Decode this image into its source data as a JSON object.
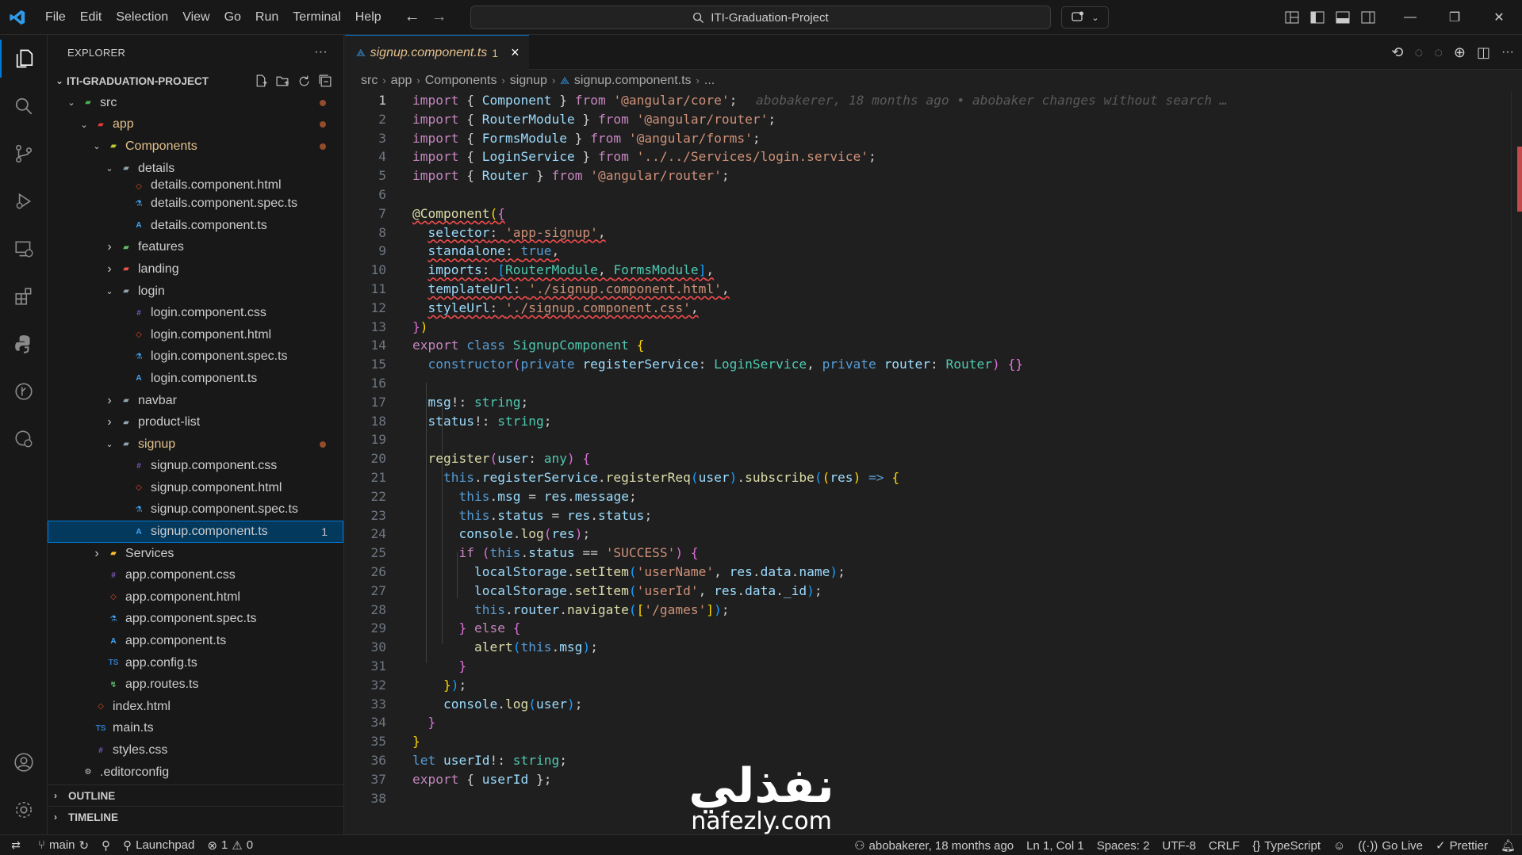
{
  "menu": [
    "File",
    "Edit",
    "Selection",
    "View",
    "Go",
    "Run",
    "Terminal",
    "Help"
  ],
  "search": {
    "label": "ITI-Graduation-Project"
  },
  "sidebar": {
    "title": "EXPLORER",
    "project": "ITI-GRADUATION-PROJECT",
    "tree": [
      {
        "label": "src",
        "depth": 1,
        "type": "folder-open",
        "icon": "src-folder-icon",
        "modified": true
      },
      {
        "label": "app",
        "depth": 2,
        "type": "folder-open",
        "icon": "app-folder-icon",
        "modified": true
      },
      {
        "label": "Components",
        "depth": 3,
        "type": "folder-open",
        "icon": "components-folder-icon",
        "modified": true
      },
      {
        "label": "details",
        "depth": 4,
        "type": "folder-open",
        "icon": "folder-icon"
      },
      {
        "label": "details.component.html",
        "depth": 5,
        "type": "file",
        "icon": "html-file-icon"
      },
      {
        "label": "details.component.spec.ts",
        "depth": 5,
        "type": "file",
        "icon": "spec-file-icon"
      },
      {
        "label": "details.component.ts",
        "depth": 5,
        "type": "file",
        "icon": "angular-file-icon"
      },
      {
        "label": "features",
        "depth": 4,
        "type": "folder",
        "icon": "features-folder-icon"
      },
      {
        "label": "landing",
        "depth": 4,
        "type": "folder",
        "icon": "landing-folder-icon"
      },
      {
        "label": "login",
        "depth": 4,
        "type": "folder-open",
        "icon": "folder-icon"
      },
      {
        "label": "login.component.css",
        "depth": 5,
        "type": "file",
        "icon": "css-file-icon"
      },
      {
        "label": "login.component.html",
        "depth": 5,
        "type": "file",
        "icon": "html-file-icon"
      },
      {
        "label": "login.component.spec.ts",
        "depth": 5,
        "type": "file",
        "icon": "spec-file-icon"
      },
      {
        "label": "login.component.ts",
        "depth": 5,
        "type": "file",
        "icon": "angular-file-icon"
      },
      {
        "label": "navbar",
        "depth": 4,
        "type": "folder",
        "icon": "folder-icon"
      },
      {
        "label": "product-list",
        "depth": 4,
        "type": "folder",
        "icon": "folder-icon"
      },
      {
        "label": "signup",
        "depth": 4,
        "type": "folder-open",
        "icon": "folder-icon",
        "modified": true
      },
      {
        "label": "signup.component.css",
        "depth": 5,
        "type": "file",
        "icon": "css-file-icon"
      },
      {
        "label": "signup.component.html",
        "depth": 5,
        "type": "file",
        "icon": "html-file-icon"
      },
      {
        "label": "signup.component.spec.ts",
        "depth": 5,
        "type": "file",
        "icon": "spec-file-icon"
      },
      {
        "label": "signup.component.ts",
        "depth": 5,
        "type": "file",
        "icon": "angular-file-icon",
        "selected": true,
        "count": "1"
      },
      {
        "label": "Services",
        "depth": 3,
        "type": "folder",
        "icon": "services-folder-icon"
      },
      {
        "label": "app.component.css",
        "depth": 3,
        "type": "file",
        "icon": "css-file-icon"
      },
      {
        "label": "app.component.html",
        "depth": 3,
        "type": "file",
        "icon": "html-file-icon"
      },
      {
        "label": "app.component.spec.ts",
        "depth": 3,
        "type": "file",
        "icon": "spec-file-icon"
      },
      {
        "label": "app.component.ts",
        "depth": 3,
        "type": "file",
        "icon": "angular-file-icon"
      },
      {
        "label": "app.config.ts",
        "depth": 3,
        "type": "file",
        "icon": "ts-file-icon"
      },
      {
        "label": "app.routes.ts",
        "depth": 3,
        "type": "file",
        "icon": "routes-file-icon"
      },
      {
        "label": "index.html",
        "depth": 2,
        "type": "file",
        "icon": "html-file-icon"
      },
      {
        "label": "main.ts",
        "depth": 2,
        "type": "file",
        "icon": "ts-file-icon"
      },
      {
        "label": "styles.css",
        "depth": 2,
        "type": "file",
        "icon": "css-file-icon"
      },
      {
        "label": ".editorconfig",
        "depth": 1,
        "type": "file",
        "icon": "editorconfig-file-icon"
      }
    ],
    "outline": "OUTLINE",
    "timeline": "TIMELINE"
  },
  "tab": {
    "name": "signup.component.ts",
    "problems": "1",
    "close": "×"
  },
  "breadcrumbs": [
    "src",
    "app",
    "Components",
    "signup",
    "signup.component.ts",
    "..."
  ],
  "blame": "abobakerer, 18 months ago • abobaker changes without search …",
  "code": [
    [
      [
        "kw2",
        "import"
      ],
      [
        "pl",
        " { "
      ],
      [
        "va",
        "Component"
      ],
      [
        "pl",
        " } "
      ],
      [
        "kw2",
        "from"
      ],
      [
        "pl",
        " "
      ],
      [
        "str",
        "'@angular/core'"
      ],
      [
        "pl",
        ";"
      ]
    ],
    [
      [
        "kw2",
        "import"
      ],
      [
        "pl",
        " { "
      ],
      [
        "va",
        "RouterModule"
      ],
      [
        "pl",
        " } "
      ],
      [
        "kw2",
        "from"
      ],
      [
        "pl",
        " "
      ],
      [
        "str",
        "'@angular/router'"
      ],
      [
        "pl",
        ";"
      ]
    ],
    [
      [
        "kw2",
        "import"
      ],
      [
        "pl",
        " { "
      ],
      [
        "va",
        "FormsModule"
      ],
      [
        "pl",
        " } "
      ],
      [
        "kw2",
        "from"
      ],
      [
        "pl",
        " "
      ],
      [
        "str",
        "'@angular/forms'"
      ],
      [
        "pl",
        ";"
      ]
    ],
    [
      [
        "kw2",
        "import"
      ],
      [
        "pl",
        " { "
      ],
      [
        "va",
        "LoginService"
      ],
      [
        "pl",
        " } "
      ],
      [
        "kw2",
        "from"
      ],
      [
        "pl",
        " "
      ],
      [
        "str",
        "'../../Services/login.service'"
      ],
      [
        "pl",
        ";"
      ]
    ],
    [
      [
        "kw2",
        "import"
      ],
      [
        "pl",
        " { "
      ],
      [
        "va",
        "Router"
      ],
      [
        "pl",
        " } "
      ],
      [
        "kw2",
        "from"
      ],
      [
        "pl",
        " "
      ],
      [
        "str",
        "'@angular/router'"
      ],
      [
        "pl",
        ";"
      ]
    ],
    [],
    [
      [
        "fn",
        "@Component"
      ],
      [
        "br1",
        "("
      ],
      [
        "br2",
        "{"
      ]
    ],
    [
      [
        "pl",
        "  "
      ],
      [
        "pr",
        "selector"
      ],
      [
        "pl",
        ": "
      ],
      [
        "str",
        "'app-signup'"
      ],
      [
        "pl",
        ","
      ]
    ],
    [
      [
        "pl",
        "  "
      ],
      [
        "pr",
        "standalone"
      ],
      [
        "pl",
        ": "
      ],
      [
        "kw",
        "true"
      ],
      [
        "pl",
        ","
      ]
    ],
    [
      [
        "pl",
        "  "
      ],
      [
        "pr",
        "imports"
      ],
      [
        "pl",
        ": "
      ],
      [
        "br3",
        "["
      ],
      [
        "ty",
        "RouterModule"
      ],
      [
        "pl",
        ", "
      ],
      [
        "ty",
        "FormsModule"
      ],
      [
        "br3",
        "]"
      ],
      [
        "pl",
        ","
      ]
    ],
    [
      [
        "pl",
        "  "
      ],
      [
        "pr",
        "templateUrl"
      ],
      [
        "pl",
        ": "
      ],
      [
        "str",
        "'./signup.component.html'"
      ],
      [
        "pl",
        ","
      ]
    ],
    [
      [
        "pl",
        "  "
      ],
      [
        "pr",
        "styleUrl"
      ],
      [
        "pl",
        ": "
      ],
      [
        "str",
        "'./signup.component.css'"
      ],
      [
        "pl",
        ","
      ]
    ],
    [
      [
        "br2",
        "}"
      ],
      [
        "br1",
        ")"
      ]
    ],
    [
      [
        "kw2",
        "export"
      ],
      [
        "pl",
        " "
      ],
      [
        "kw",
        "class"
      ],
      [
        "pl",
        " "
      ],
      [
        "ty",
        "SignupComponent"
      ],
      [
        "pl",
        " "
      ],
      [
        "br1",
        "{"
      ]
    ],
    [
      [
        "pl",
        "  "
      ],
      [
        "kw",
        "constructor"
      ],
      [
        "br2",
        "("
      ],
      [
        "kw",
        "private"
      ],
      [
        "pl",
        " "
      ],
      [
        "va",
        "registerService"
      ],
      [
        "pl",
        ": "
      ],
      [
        "ty",
        "LoginService"
      ],
      [
        "pl",
        ", "
      ],
      [
        "kw",
        "private"
      ],
      [
        "pl",
        " "
      ],
      [
        "va",
        "router"
      ],
      [
        "pl",
        ": "
      ],
      [
        "ty",
        "Router"
      ],
      [
        "br2",
        ")"
      ],
      [
        "pl",
        " "
      ],
      [
        "br2",
        "{}"
      ]
    ],
    [],
    [
      [
        "pl",
        "  "
      ],
      [
        "va",
        "msg"
      ],
      [
        "pl",
        "!: "
      ],
      [
        "ty",
        "string"
      ],
      [
        "pl",
        ";"
      ]
    ],
    [
      [
        "pl",
        "  "
      ],
      [
        "va",
        "status"
      ],
      [
        "pl",
        "!: "
      ],
      [
        "ty",
        "string"
      ],
      [
        "pl",
        ";"
      ]
    ],
    [],
    [
      [
        "pl",
        "  "
      ],
      [
        "fn",
        "register"
      ],
      [
        "br2",
        "("
      ],
      [
        "va",
        "user"
      ],
      [
        "pl",
        ": "
      ],
      [
        "ty",
        "any"
      ],
      [
        "br2",
        ")"
      ],
      [
        "pl",
        " "
      ],
      [
        "br2",
        "{"
      ]
    ],
    [
      [
        "pl",
        "    "
      ],
      [
        "kw",
        "this"
      ],
      [
        "pl",
        "."
      ],
      [
        "va",
        "registerService"
      ],
      [
        "pl",
        "."
      ],
      [
        "fn",
        "registerReq"
      ],
      [
        "br3",
        "("
      ],
      [
        "va",
        "user"
      ],
      [
        "br3",
        ")"
      ],
      [
        "pl",
        "."
      ],
      [
        "fn",
        "subscribe"
      ],
      [
        "br3",
        "("
      ],
      [
        "br1",
        "("
      ],
      [
        "va",
        "res"
      ],
      [
        "br1",
        ")"
      ],
      [
        "pl",
        " "
      ],
      [
        "kw",
        "=>"
      ],
      [
        "pl",
        " "
      ],
      [
        "br1",
        "{"
      ]
    ],
    [
      [
        "pl",
        "      "
      ],
      [
        "kw",
        "this"
      ],
      [
        "pl",
        "."
      ],
      [
        "va",
        "msg"
      ],
      [
        "pl",
        " = "
      ],
      [
        "va",
        "res"
      ],
      [
        "pl",
        "."
      ],
      [
        "va",
        "message"
      ],
      [
        "pl",
        ";"
      ]
    ],
    [
      [
        "pl",
        "      "
      ],
      [
        "kw",
        "this"
      ],
      [
        "pl",
        "."
      ],
      [
        "va",
        "status"
      ],
      [
        "pl",
        " = "
      ],
      [
        "va",
        "res"
      ],
      [
        "pl",
        "."
      ],
      [
        "va",
        "status"
      ],
      [
        "pl",
        ";"
      ]
    ],
    [
      [
        "pl",
        "      "
      ],
      [
        "va",
        "console"
      ],
      [
        "pl",
        "."
      ],
      [
        "fn",
        "log"
      ],
      [
        "br2",
        "("
      ],
      [
        "va",
        "res"
      ],
      [
        "br2",
        ")"
      ],
      [
        "pl",
        ";"
      ]
    ],
    [
      [
        "pl",
        "      "
      ],
      [
        "kw2",
        "if"
      ],
      [
        "pl",
        " "
      ],
      [
        "br2",
        "("
      ],
      [
        "kw",
        "this"
      ],
      [
        "pl",
        "."
      ],
      [
        "va",
        "status"
      ],
      [
        "pl",
        " == "
      ],
      [
        "str",
        "'SUCCESS'"
      ],
      [
        "br2",
        ")"
      ],
      [
        "pl",
        " "
      ],
      [
        "br2",
        "{"
      ]
    ],
    [
      [
        "pl",
        "        "
      ],
      [
        "va",
        "localStorage"
      ],
      [
        "pl",
        "."
      ],
      [
        "fn",
        "setItem"
      ],
      [
        "br3",
        "("
      ],
      [
        "str",
        "'userName'"
      ],
      [
        "pl",
        ", "
      ],
      [
        "va",
        "res"
      ],
      [
        "pl",
        "."
      ],
      [
        "va",
        "data"
      ],
      [
        "pl",
        "."
      ],
      [
        "va",
        "name"
      ],
      [
        "br3",
        ")"
      ],
      [
        "pl",
        ";"
      ]
    ],
    [
      [
        "pl",
        "        "
      ],
      [
        "va",
        "localStorage"
      ],
      [
        "pl",
        "."
      ],
      [
        "fn",
        "setItem"
      ],
      [
        "br3",
        "("
      ],
      [
        "str",
        "'userId'"
      ],
      [
        "pl",
        ", "
      ],
      [
        "va",
        "res"
      ],
      [
        "pl",
        "."
      ],
      [
        "va",
        "data"
      ],
      [
        "pl",
        "."
      ],
      [
        "va",
        "_id"
      ],
      [
        "br3",
        ")"
      ],
      [
        "pl",
        ";"
      ]
    ],
    [
      [
        "pl",
        "        "
      ],
      [
        "kw",
        "this"
      ],
      [
        "pl",
        "."
      ],
      [
        "va",
        "router"
      ],
      [
        "pl",
        "."
      ],
      [
        "fn",
        "navigate"
      ],
      [
        "br3",
        "("
      ],
      [
        "br1",
        "["
      ],
      [
        "str",
        "'/games'"
      ],
      [
        "br1",
        "]"
      ],
      [
        "br3",
        ")"
      ],
      [
        "pl",
        ";"
      ]
    ],
    [
      [
        "pl",
        "      "
      ],
      [
        "br2",
        "}"
      ],
      [
        "pl",
        " "
      ],
      [
        "kw2",
        "else"
      ],
      [
        "pl",
        " "
      ],
      [
        "br2",
        "{"
      ]
    ],
    [
      [
        "pl",
        "        "
      ],
      [
        "fn",
        "alert"
      ],
      [
        "br3",
        "("
      ],
      [
        "kw",
        "this"
      ],
      [
        "pl",
        "."
      ],
      [
        "va",
        "msg"
      ],
      [
        "br3",
        ")"
      ],
      [
        "pl",
        ";"
      ]
    ],
    [
      [
        "pl",
        "      "
      ],
      [
        "br2",
        "}"
      ]
    ],
    [
      [
        "pl",
        "    "
      ],
      [
        "br1",
        "}"
      ],
      [
        "br3",
        ")"
      ],
      [
        "pl",
        ";"
      ]
    ],
    [
      [
        "pl",
        "    "
      ],
      [
        "va",
        "console"
      ],
      [
        "pl",
        "."
      ],
      [
        "fn",
        "log"
      ],
      [
        "br3",
        "("
      ],
      [
        "va",
        "user"
      ],
      [
        "br3",
        ")"
      ],
      [
        "pl",
        ";"
      ]
    ],
    [
      [
        "pl",
        "  "
      ],
      [
        "br2",
        "}"
      ]
    ],
    [
      [
        "br1",
        "}"
      ]
    ],
    [
      [
        "kw",
        "let"
      ],
      [
        "pl",
        " "
      ],
      [
        "va",
        "userId"
      ],
      [
        "pl",
        "!: "
      ],
      [
        "ty",
        "string"
      ],
      [
        "pl",
        ";"
      ]
    ],
    [
      [
        "kw2",
        "export"
      ],
      [
        "pl",
        " { "
      ],
      [
        "va",
        "userId"
      ],
      [
        "pl",
        " };"
      ]
    ],
    []
  ],
  "squiggle_lines": [
    7,
    8,
    9,
    10,
    11,
    12
  ],
  "status": {
    "branch": "main",
    "launchpad": "Launchpad",
    "errors": "1",
    "warnings": "0",
    "blame": "abobakerer, 18 months ago",
    "position": "Ln 1, Col 1",
    "spaces": "Spaces: 2",
    "encoding": "UTF-8",
    "eol": "CRLF",
    "language": "TypeScript",
    "golive": "Go Live",
    "prettier": "Prettier"
  },
  "watermark": {
    "arabic": "نفذلي",
    "latin": "nafezly.com"
  },
  "colors": {
    "accent": "#0078d4",
    "modified": "#e2c08d",
    "selection": "#04395e"
  }
}
